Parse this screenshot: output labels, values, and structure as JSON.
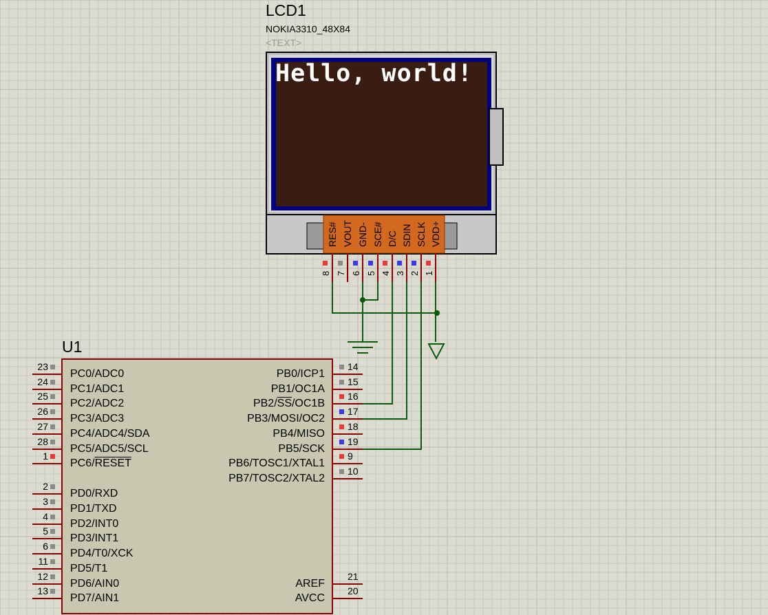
{
  "lcd": {
    "ref": "LCD1",
    "value": "NOKIA3310_48X84",
    "text_field": "<TEXT>",
    "message": "Hello, world!",
    "pins": [
      {
        "name": "RES#",
        "num": "8",
        "state": "red"
      },
      {
        "name": "VOUT",
        "num": "7",
        "state": "gray"
      },
      {
        "name": "GND-",
        "num": "6",
        "state": "blue"
      },
      {
        "name": "SCE#",
        "num": "5",
        "state": "blue"
      },
      {
        "name": "D/C",
        "num": "4",
        "state": "red"
      },
      {
        "name": "SDIN",
        "num": "3",
        "state": "blue"
      },
      {
        "name": "SCLK",
        "num": "2",
        "state": "blue"
      },
      {
        "name": "VDD+",
        "num": "1",
        "state": "red"
      }
    ]
  },
  "mcu": {
    "ref": "U1",
    "left_pins": [
      {
        "name": "PC0/ADC0",
        "num": "23",
        "state": "gray"
      },
      {
        "name": "PC1/ADC1",
        "num": "24",
        "state": "gray"
      },
      {
        "name": "PC2/ADC2",
        "num": "25",
        "state": "gray"
      },
      {
        "name": "PC3/ADC3",
        "num": "26",
        "state": "gray"
      },
      {
        "name": "PC4/ADC4/SDA",
        "num": "27",
        "state": "gray"
      },
      {
        "name": "PC5/ADC5/SCL",
        "num": "28",
        "state": "gray"
      },
      {
        "name": "PC6/RESET",
        "num": "1",
        "state": "red"
      },
      {
        "name": "PD0/RXD",
        "num": "2",
        "state": "gray"
      },
      {
        "name": "PD1/TXD",
        "num": "3",
        "state": "gray"
      },
      {
        "name": "PD2/INT0",
        "num": "4",
        "state": "gray"
      },
      {
        "name": "PD3/INT1",
        "num": "5",
        "state": "gray"
      },
      {
        "name": "PD4/T0/XCK",
        "num": "6",
        "state": "gray"
      },
      {
        "name": "PD5/T1",
        "num": "11",
        "state": "gray"
      },
      {
        "name": "PD6/AIN0",
        "num": "12",
        "state": "gray"
      },
      {
        "name": "PD7/AIN1",
        "num": "13",
        "state": "gray"
      }
    ],
    "right_pins": [
      {
        "name": "PB0/ICP1",
        "num": "14",
        "state": "gray"
      },
      {
        "name": "PB1/OC1A",
        "num": "15",
        "state": "gray"
      },
      {
        "name": "PB2/SS/OC1B",
        "num": "16",
        "state": "red"
      },
      {
        "name": "PB3/MOSI/OC2",
        "num": "17",
        "state": "blue"
      },
      {
        "name": "PB4/MISO",
        "num": "18",
        "state": "red"
      },
      {
        "name": "PB5/SCK",
        "num": "19",
        "state": "blue"
      },
      {
        "name": "PB6/TOSC1/XTAL1",
        "num": "9",
        "state": "red"
      },
      {
        "name": "PB7/TOSC2/XTAL2",
        "num": "10",
        "state": "gray"
      },
      {
        "name": "AREF",
        "num": "21",
        "state": "none"
      },
      {
        "name": "AVCC",
        "num": "20",
        "state": "none"
      }
    ]
  },
  "colors": {
    "background": "#dcdcd0",
    "grid": "#c8c8bc",
    "wire": "#0b5a0b",
    "pin_line": "#8b0000",
    "body_fill": "#c8c8b0",
    "lcd_bezel": "#000080",
    "lcd_screen": "#3a1d12",
    "connector": "#d2691e",
    "state_red": "#e83a3a",
    "state_blue": "#3a3ae8",
    "state_gray": "#8a8a8a"
  }
}
